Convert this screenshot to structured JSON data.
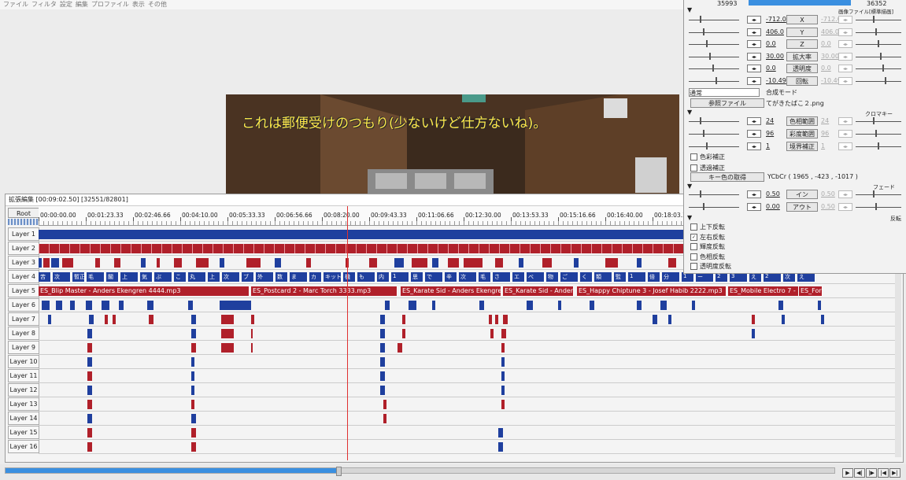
{
  "menu": [
    "ファイル",
    "フィルタ",
    "設定",
    "編集",
    "プロファイル",
    "表示",
    "その他"
  ],
  "preview": {
    "subtitle": "これは郵便受けのつもり(少ないけど仕方ないね)。"
  },
  "timeline": {
    "title": "拡張編集 [00:09:02.50] [32551/82801]",
    "root_label": "Root",
    "ticks": [
      "00:00:00.00",
      "00:01:23.33",
      "00:02:46.66",
      "00:04:10.00",
      "00:05:33.33",
      "00:06:56.66",
      "00:08:20.00",
      "00:09:43.33",
      "00:11:06.66",
      "00:12:30.00",
      "00:13:53.33",
      "00:15:16.66",
      "00:16:40.00",
      "00:18:03.3"
    ],
    "layers": [
      "Layer 1",
      "Layer 2",
      "Layer 3",
      "Layer 4",
      "Layer 5",
      "Layer 6",
      "Layer 7",
      "Layer 8",
      "Layer 9",
      "Layer 10",
      "Layer 11",
      "Layer 12",
      "Layer 13",
      "Layer 14",
      "Layer 15",
      "Layer 16"
    ],
    "audio_clips": [
      "ES_Blip Master - Anders Ekengren 4444.mp3",
      "ES_Postcard 2 - Marc Torch 3333.mp3",
      "ES_Karate Sid - Anders Ekengren",
      "ES_Karate Sid - Anders",
      "ES_Happy Chiptune 3 - Josef Habib 2222.mp3",
      "ES_Mobile Electro 7 - M",
      "ES_Fore"
    ],
    "layer4_text": [
      "苦",
      "次",
      "暫正",
      "毛",
      "閣",
      "上",
      "気",
      "ぶ",
      "こ",
      "丸",
      "上",
      "次",
      "ブ",
      "外",
      "数",
      "ま",
      "カ",
      "キット",
      "機",
      "も",
      "内",
      "1",
      "思",
      "で",
      "辛",
      "次",
      "毛",
      "さ",
      "エ",
      "べ",
      "物",
      "ご",
      "く",
      "類",
      "監",
      "1",
      "倍",
      "分",
      "1",
      "ー",
      "2",
      "3",
      "え",
      "2",
      "次",
      "え"
    ],
    "playhead": "00:08:20.00",
    "progress": 0.4
  },
  "panel": {
    "frame_start": "35993",
    "frame_end": "36352",
    "file_type": "画像ファイル[標準描画]",
    "params": [
      {
        "label": "X",
        "value": "-712.0",
        "value2": "-712.0"
      },
      {
        "label": "Y",
        "value": "406.0",
        "value2": "406.0"
      },
      {
        "label": "Z",
        "value": "0.0",
        "value2": "0.0"
      },
      {
        "label": "拡大率",
        "value": "30.00",
        "value2": "30.00"
      },
      {
        "label": "透明度",
        "value": "0.0",
        "value2": "0.0"
      },
      {
        "label": "回転",
        "value": "-10.49",
        "value2": "-10.49"
      }
    ],
    "blend_mode": "通常",
    "blend_label": "合成モード",
    "ref_file_button": "参照ファイル",
    "file_name": "てがきたばこ２.png",
    "chroma_header": "クロマキー",
    "chroma_params": [
      {
        "label": "色相範囲",
        "value": "24",
        "value2": "24"
      },
      {
        "label": "彩度範囲",
        "value": "96",
        "value2": "96"
      },
      {
        "label": "境界補正",
        "value": "1",
        "value2": "1"
      }
    ],
    "color_correct": "色彩補正",
    "transparency_correct": "透過補正",
    "key_color_button": "キー色の取得",
    "ycbcr": "YCbCr ( 1965 , -423 , -1017 )",
    "fade_header": "フェード",
    "fade_params": [
      {
        "label": "イン",
        "value": "0.50",
        "value2": "0.50"
      },
      {
        "label": "アウト",
        "value": "0.00",
        "value2": "0.50"
      }
    ],
    "flip_header": "反転",
    "flips": [
      {
        "label": "上下反転",
        "checked": false
      },
      {
        "label": "左右反転",
        "checked": true
      },
      {
        "label": "輝度反転",
        "checked": false
      },
      {
        "label": "色相反転",
        "checked": false
      },
      {
        "label": "透明度反転",
        "checked": false
      }
    ]
  },
  "colors": {
    "blue": "#1f3f9e",
    "red": "#b0202a",
    "accent": "#3a8fe0"
  }
}
